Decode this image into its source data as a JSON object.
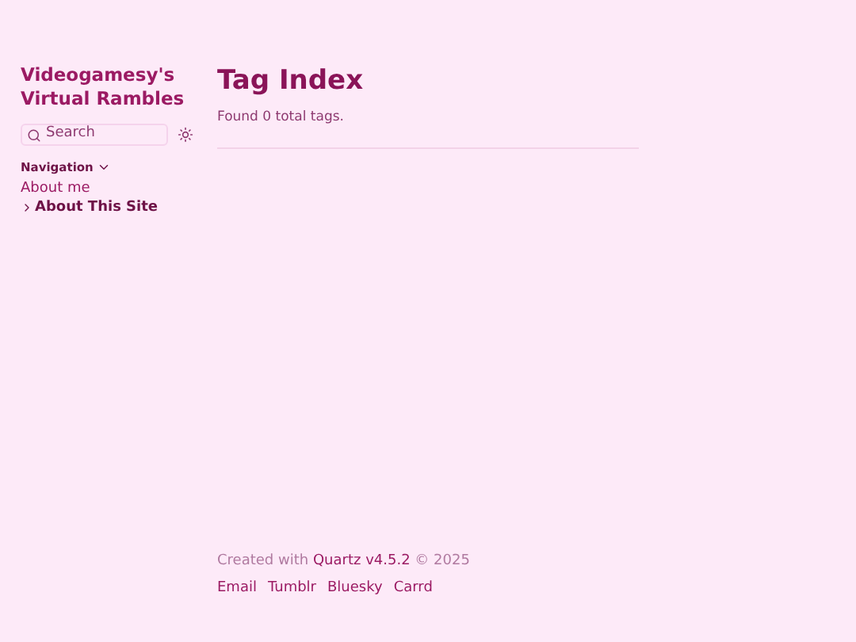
{
  "site_title": "Videogamesy's Virtual Rambles",
  "search": {
    "placeholder": "Search"
  },
  "navigation": {
    "label": "Navigation",
    "expanded": true,
    "items": [
      {
        "kind": "page",
        "label": "About me"
      },
      {
        "kind": "folder",
        "label": "About This Site",
        "expanded": false
      }
    ]
  },
  "page": {
    "title": "Tag Index",
    "summary": "Found 0 total tags."
  },
  "footer": {
    "credit_before": "Created with",
    "credit_link": "Quartz v4.5.2",
    "credit_after": "© 2025",
    "links": [
      "Email",
      "Tumblr",
      "Bluesky",
      "Carrd"
    ]
  }
}
